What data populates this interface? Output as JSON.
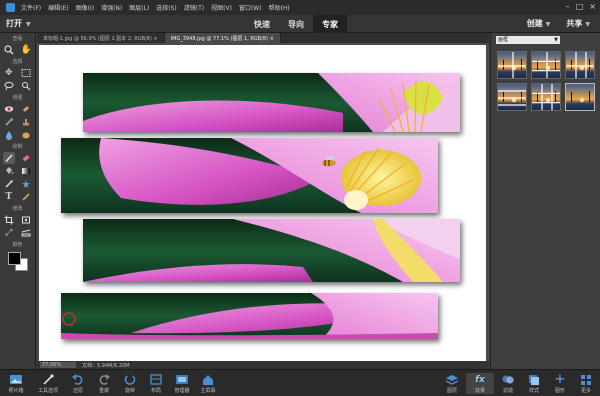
{
  "menubar": {
    "items": [
      "文件(F)",
      "编辑(E)",
      "图像(I)",
      "增强(N)",
      "图层(L)",
      "选择(S)",
      "滤镜(T)",
      "视图(V)",
      "窗口(W)",
      "帮助(H)"
    ]
  },
  "modebar": {
    "open_label": "打开",
    "modes": [
      "快速",
      "导向",
      "专家"
    ],
    "active_mode": "专家",
    "create_label": "创建",
    "share_label": "共享"
  },
  "toolbox": {
    "sections": [
      "查看",
      "选择",
      "增强",
      "绘制",
      "修改",
      "颜色"
    ]
  },
  "tabs": [
    "未标题-1.jpg @ 56.9% (图层 1 副本 2, RGB/8)",
    "IMG_3948.jpg @ 77.1% (图层 1, RGB/8)"
  ],
  "statusbar": {
    "zoom": "77.06%",
    "doc": "文档：5.94M/6.20M"
  },
  "rpanel": {
    "category": "画框"
  },
  "bottombar": {
    "left_buttons": [
      "照片箱",
      "工具选项",
      "还原",
      "重做",
      "旋转",
      "布局",
      "管理器",
      "主屏幕"
    ],
    "right_buttons": [
      "图层",
      "效果",
      "滤镜",
      "样式",
      "图形",
      "更多"
    ]
  },
  "colors": {
    "accent": "#3a8fd9",
    "petal": "#d54fc0",
    "leaf": "#1a5a34"
  }
}
